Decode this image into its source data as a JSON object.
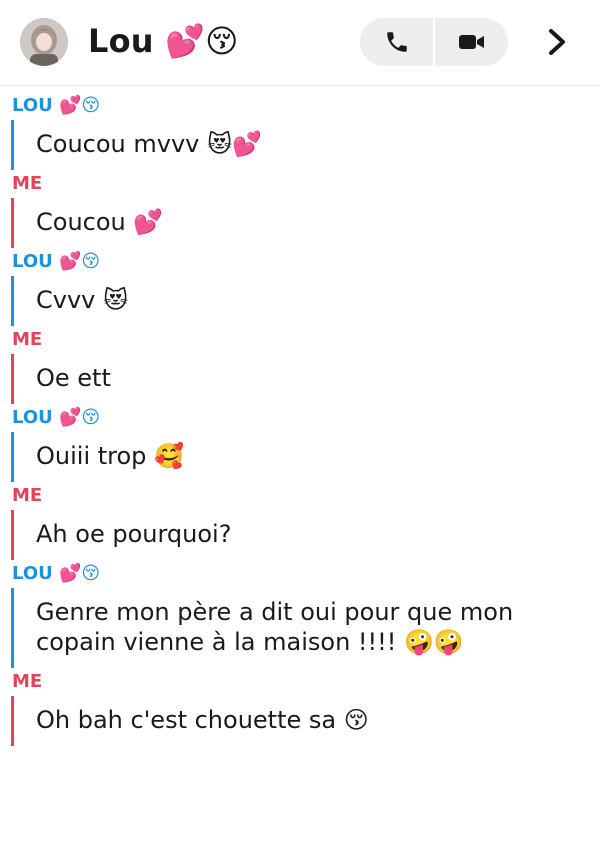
{
  "header": {
    "contact_name": "Lou 💕😚",
    "avatar_icon": "profile-avatar",
    "call_icon": "phone-icon",
    "video_icon": "video-camera-icon",
    "chevron_icon": "chevron-right-icon"
  },
  "colors": {
    "lou": "#1a93e0",
    "me": "#e8415b"
  },
  "messages": [
    {
      "sender": "LOU 💕😚",
      "text": "Coucou mvvv 😻💕"
    },
    {
      "sender": "ME",
      "text": "Coucou 💕"
    },
    {
      "sender": "LOU 💕😚",
      "text": "Cvvv 😻"
    },
    {
      "sender": "ME",
      "text": "Oe ett"
    },
    {
      "sender": "LOU 💕😚",
      "text": "Ouiii trop 🥰"
    },
    {
      "sender": "ME",
      "text": "Ah oe pourquoi?"
    },
    {
      "sender": "LOU 💕😚",
      "text": "Genre mon père a dit oui pour que mon copain vienne à la maison !!!! 🤪🤪"
    },
    {
      "sender": "ME",
      "text": "Oh bah c'est chouette sa 😚"
    }
  ]
}
